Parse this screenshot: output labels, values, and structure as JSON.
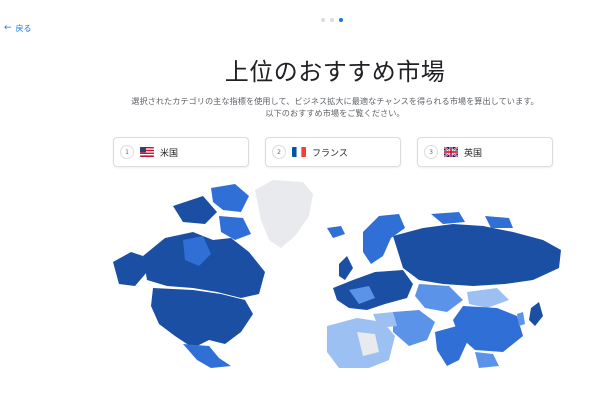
{
  "nav": {
    "back_label": "戻る"
  },
  "steps": {
    "total": 3,
    "current": 3
  },
  "page": {
    "title": "上位のおすすめ市場",
    "description_line1": "選択されたカテゴリの主な指標を使用して、ビジネス拡大に最適なチャンスを得られる市場を算出しています。",
    "description_line2": "以下のおすすめ市場をご覧ください。"
  },
  "markets": [
    {
      "rank": "1",
      "country": "米国",
      "flag_icon": "us-flag-icon"
    },
    {
      "rank": "2",
      "country": "フランス",
      "flag_icon": "france-flag-icon"
    },
    {
      "rank": "3",
      "country": "英国",
      "flag_icon": "uk-flag-icon"
    }
  ],
  "map": {
    "icon": "world-map",
    "colors": {
      "dark": "#1a4fa3",
      "medium": "#2f6fd6",
      "light": "#5b93e8",
      "pale": "#9cc0f2",
      "no_data": "#e8eaed"
    }
  },
  "colors": {
    "accent": "#1a73e8",
    "text": "#202124",
    "muted": "#5f6368",
    "border": "#dadce0"
  }
}
